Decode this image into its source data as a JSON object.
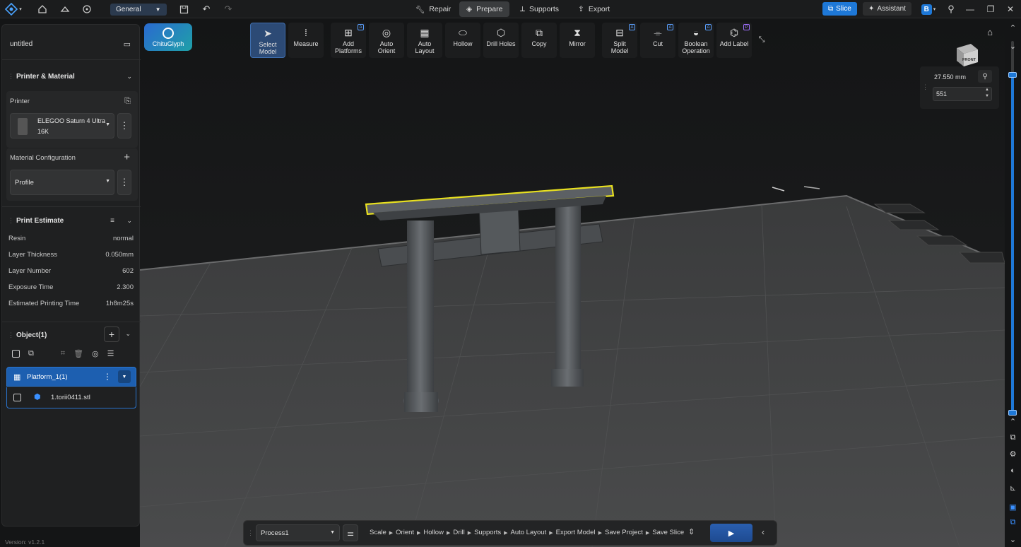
{
  "topbar": {
    "workspace": "General",
    "tabs": [
      {
        "label": "Repair",
        "icon": "wrench-icon"
      },
      {
        "label": "Prepare",
        "icon": "cube-icon",
        "active": true
      },
      {
        "label": "Supports",
        "icon": "supports-icon"
      },
      {
        "label": "Export",
        "icon": "export-icon"
      }
    ],
    "slice_label": "Slice",
    "assistant_label": "Assistant",
    "accent": "#1e78d7"
  },
  "left": {
    "project_title": "untitled",
    "printer_material": {
      "title": "Printer & Material",
      "printer_label": "Printer",
      "printer_name_line1": "ELEGOO Saturn 4 Ultra",
      "printer_name_line2": "16K",
      "material_label": "Material Configuration",
      "profile": "Profile"
    },
    "estimate": {
      "title": "Print Estimate",
      "rows": [
        {
          "label": "Resin",
          "value": "normal"
        },
        {
          "label": "Layer Thickness",
          "value": "0.050mm"
        },
        {
          "label": "Layer Number",
          "value": "602"
        },
        {
          "label": "Exposure Time",
          "value": "2.300"
        },
        {
          "label": "Estimated Printing Time",
          "value": "1h8m25s"
        }
      ]
    },
    "objects": {
      "title": "Object(1)",
      "platform": "Platform_1(1)",
      "file": "1.torii0411.stl"
    },
    "version": "Version: v1.2.1"
  },
  "chitu_label": "ChituGlyph",
  "toolbar": [
    {
      "label1": "Select",
      "label2": "Model",
      "icon": "cursor-icon",
      "active": true,
      "badge": ""
    },
    {
      "label1": "Measure",
      "label2": "",
      "icon": "ruler-icon",
      "badge": ""
    },
    {
      "label1": "Add",
      "label2": "Platforms",
      "icon": "add-platform-icon",
      "badge": "A"
    },
    {
      "label1": "Auto",
      "label2": "Orient",
      "icon": "orient-icon",
      "badge": ""
    },
    {
      "label1": "Auto",
      "label2": "Layout",
      "icon": "layout-icon",
      "badge": ""
    },
    {
      "label1": "Hollow",
      "label2": "",
      "icon": "hollow-icon",
      "badge": ""
    },
    {
      "label1": "Drill Holes",
      "label2": "",
      "icon": "drill-icon",
      "badge": ""
    },
    {
      "label1": "Copy",
      "label2": "",
      "icon": "copy-icon",
      "badge": ""
    },
    {
      "label1": "Mirror",
      "label2": "",
      "icon": "mirror-icon",
      "badge": ""
    },
    {
      "label1": "Split",
      "label2": "Model",
      "icon": "split-icon",
      "badge": "A"
    },
    {
      "label1": "Cut",
      "label2": "",
      "icon": "cut-icon",
      "badge": "A"
    },
    {
      "label1": "Boolean",
      "label2": "Operation",
      "icon": "boolean-icon",
      "badge": "A"
    },
    {
      "label1": "Add Label",
      "label2": "",
      "icon": "label-icon",
      "badge": "P"
    }
  ],
  "layer_panel": {
    "height_mm": "27.550 mm",
    "layer": "551"
  },
  "layer_slider": {
    "max": 602,
    "upper_layer": 551,
    "lower_layer": 0
  },
  "view_cube": {
    "label": "FRONT"
  },
  "bottombar": {
    "process": "Process1",
    "steps": [
      "Scale",
      "Orient",
      "Hollow",
      "Drill",
      "Supports",
      "Auto Layout",
      "Export Model",
      "Save Project",
      "Save Slice"
    ]
  }
}
